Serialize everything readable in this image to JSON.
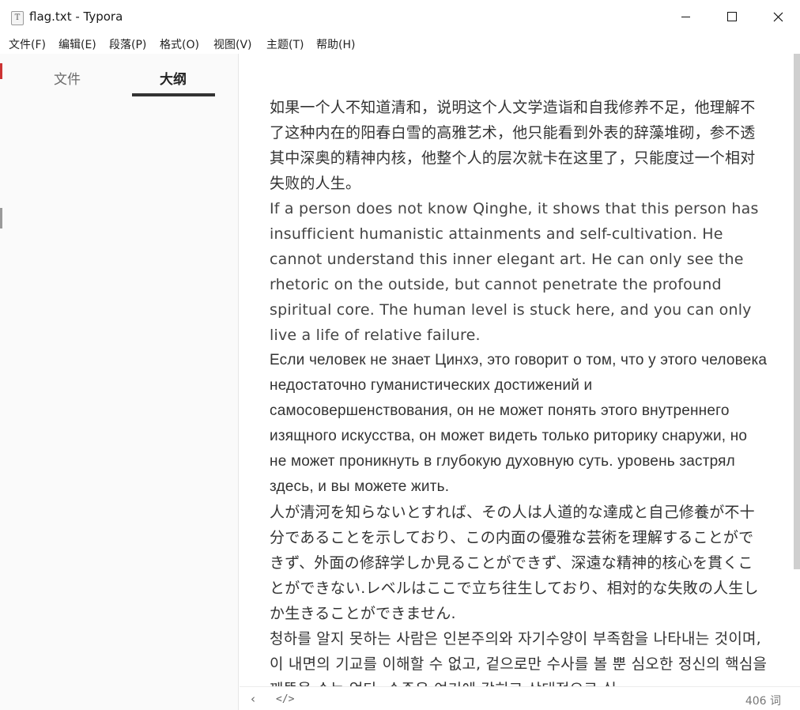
{
  "window": {
    "title": "flag.txt - Typora",
    "app_icon_glyph": "T"
  },
  "menu": {
    "items": [
      "文件(F)",
      "编辑(E)",
      "段落(P)",
      "格式(O)",
      "视图(V)",
      "主题(T)",
      "帮助(H)"
    ]
  },
  "sidebar": {
    "tabs": [
      "文件",
      "大纲"
    ],
    "active_tab": "大纲"
  },
  "document": {
    "paragraphs": [
      "如果一个人不知道清和，说明这个人文学造诣和自我修养不足，他理解不了这种内在的阳春白雪的高雅艺术，他只能看到外表的辞藻堆砌，参不透其中深奥的精神内核，他整个人的层次就卡在这里了，只能度过一个相对失败的人生。",
      "If a person does not know Qinghe, it shows that this person has insufficient humanistic attainments and self-cultivation. He cannot understand this inner elegant art. He can only see the rhetoric on the outside, but cannot penetrate the profound spiritual core. The human level is stuck here, and you can only live a life of relative failure.",
      "Если человек не знает Цинхэ, это говорит о том, что у этого человека недостаточно гуманистических достижений и самосовершенствования, он не может понять этого внутреннего изящного искусства, он может видеть только риторику снаружи, но не может проникнуть в глубокую духовную суть. уровень застрял здесь, и вы можете жить.",
      "人が清河を知らないとすれば、その人は人道的な達成と自己修養が不十分であることを示しており、この内面の優雅な芸術を理解することができず、外面の修辞学しか見ることができず、深遠な精神的核心を貫くことができない.レベルはここで立ち往生しており、相対的な失敗の人生しか生きることができません.",
      "청하를 알지 못하는 사람은 인본주의와 자기수양이 부족함을 나타내는 것이며, 이 내면의 기교를 이해할 수 없고, 겉으로만 수사를 볼 뿐 심오한 정신의 핵심을 꿰뚫을 수는 없다. 수준은 여기에 갇히고 상대적으로 실"
    ]
  },
  "status": {
    "back_icon": "chevron-left-icon",
    "source_icon": "code-icon",
    "back_glyph": "‹",
    "source_glyph": "</>",
    "word_count": "406 词"
  },
  "colors": {
    "sidebar_bg": "#fafafa",
    "editor_text": "#333333",
    "active_tab_underline": "#333333",
    "scroll_thumb": "#cfcfcf"
  }
}
